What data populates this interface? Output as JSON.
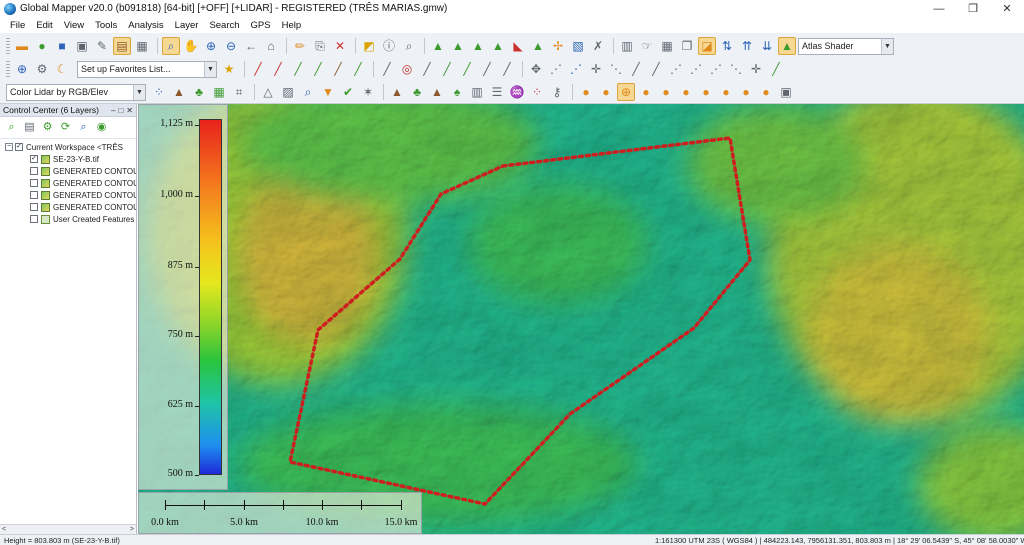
{
  "window": {
    "title": "Global Mapper v20.0 (b091818) [64-bit] [+OFF] [+LIDAR] - REGISTERED (TRÊS MARIAS.gmw)",
    "controls": {
      "minimize": "—",
      "maximize": "❐",
      "close": "✕"
    }
  },
  "menu": [
    "File",
    "Edit",
    "View",
    "Tools",
    "Analysis",
    "Layer",
    "Search",
    "GPS",
    "Help"
  ],
  "toolbar": {
    "shader_select": "Atlas Shader",
    "favorites_select": "Set up Favorites List...",
    "lidar_color_select": "Color Lidar by RGB/Elev"
  },
  "control_center": {
    "title": "Control Center (6 Layers)",
    "header_buttons": [
      "–",
      "□",
      "✕"
    ],
    "workspace": "Current Workspace <TRÊS",
    "layers": [
      {
        "name": "SE-23-Y-B.tif",
        "checked": "✓",
        "kind": "raster"
      },
      {
        "name": "GENERATED CONTOUR",
        "checked": "",
        "kind": "contour"
      },
      {
        "name": "GENERATED CONTOUR",
        "checked": "",
        "kind": "contour"
      },
      {
        "name": "GENERATED CONTOUR",
        "checked": "",
        "kind": "contour"
      },
      {
        "name": "GENERATED CONTOUR",
        "checked": "",
        "kind": "contour"
      },
      {
        "name": "User Created Features [",
        "checked": "",
        "kind": "feature"
      }
    ],
    "scroll_left": "<",
    "scroll_right": ">"
  },
  "legend": {
    "labels": [
      "1,125 m",
      "1,000 m",
      "875 m",
      "750 m",
      "625 m",
      "500 m"
    ],
    "min_value": 500,
    "max_value": 1125,
    "colors": [
      "#e8221c",
      "#f4791d",
      "#f5c11d",
      "#e5e81d",
      "#8ad42a",
      "#29c43d",
      "#1fc4a6",
      "#1e8ef0",
      "#1e2ad8"
    ]
  },
  "scale_bar": {
    "labels": [
      "0.0 km",
      "5.0 km",
      "10.0 km",
      "15.0 km"
    ]
  },
  "status": {
    "left": "Height = 803.803 m (SE-23-Y-B.tif)",
    "right": "1:161300   UTM 23S ( WGS84 ) | 484223.143, 7956131.351, 803.803 m |  18° 29' 06.5439\" S, 45° 08' 58.0030\" W"
  },
  "colors": {
    "polygon_outline": "#cc1f1f",
    "map_base": "#1fb58a",
    "highland": "#c9c030"
  }
}
